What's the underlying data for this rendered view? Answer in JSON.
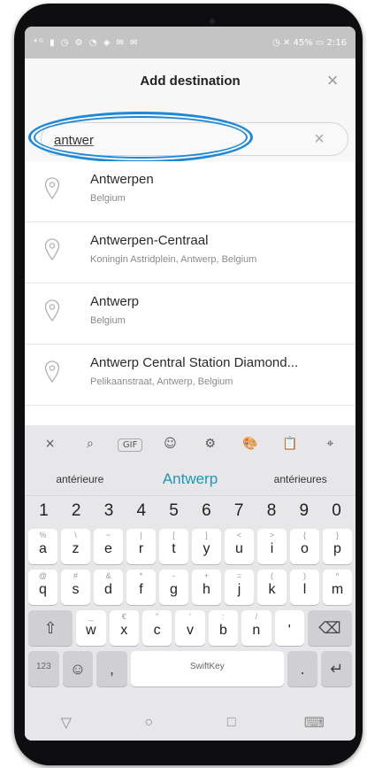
{
  "status_bar": {
    "left_icons": "⁴ᴳ ▮ ◷ ⚙ ◔ ◈ ✉ ✉",
    "right": "◷ ✕ 45% ▭ 2:16"
  },
  "header": {
    "title": "Add destination",
    "close_icon": "×"
  },
  "search": {
    "value": "antwer",
    "clear_icon": "×"
  },
  "results": [
    {
      "name": "Antwerpen",
      "sub": "Belgium"
    },
    {
      "name": "Antwerpen-Centraal",
      "sub": "Koningin Astridplein, Antwerp, Belgium"
    },
    {
      "name": "Antwerp",
      "sub": "Belgium"
    },
    {
      "name": "Antwerp Central Station Diamond...",
      "sub": "Pelikaanstraat, Antwerp, Belgium"
    }
  ],
  "keyboard": {
    "toolbar": [
      "×",
      "⌕",
      "GIF",
      "☺",
      "⚙",
      "🎨",
      "📋",
      "⌖"
    ],
    "suggestions": [
      "antérieure",
      "Antwerp",
      "antérieures"
    ],
    "numbers": [
      "1",
      "2",
      "3",
      "4",
      "5",
      "6",
      "7",
      "8",
      "9",
      "0"
    ],
    "row1": [
      {
        "main": "a",
        "alt": "%"
      },
      {
        "main": "z",
        "alt": "\\"
      },
      {
        "main": "e",
        "alt": "~"
      },
      {
        "main": "r",
        "alt": "|"
      },
      {
        "main": "t",
        "alt": "["
      },
      {
        "main": "y",
        "alt": "]"
      },
      {
        "main": "u",
        "alt": "<"
      },
      {
        "main": "i",
        "alt": ">"
      },
      {
        "main": "o",
        "alt": "{"
      },
      {
        "main": "p",
        "alt": "}"
      }
    ],
    "row2": [
      {
        "main": "q",
        "alt": "@"
      },
      {
        "main": "s",
        "alt": "#"
      },
      {
        "main": "d",
        "alt": "&"
      },
      {
        "main": "f",
        "alt": "*"
      },
      {
        "main": "g",
        "alt": "-"
      },
      {
        "main": "h",
        "alt": "+"
      },
      {
        "main": "j",
        "alt": "="
      },
      {
        "main": "k",
        "alt": "("
      },
      {
        "main": "l",
        "alt": ")"
      },
      {
        "main": "m",
        "alt": "^"
      }
    ],
    "row3": [
      {
        "main": "w",
        "alt": "_"
      },
      {
        "main": "x",
        "alt": "€"
      },
      {
        "main": "c",
        "alt": "\""
      },
      {
        "main": "v",
        "alt": "'"
      },
      {
        "main": "b",
        "alt": ":"
      },
      {
        "main": "n",
        "alt": "/"
      },
      {
        "main": "'",
        "alt": ""
      }
    ],
    "shift_icon": "⇧",
    "backspace_icon": "⌫",
    "symbols_key": "123",
    "emoji_icon": "☺",
    "comma_key": ",",
    "space_label": "SwiftKey",
    "period_key": ".",
    "enter_icon": "↵"
  },
  "nav_bar": {
    "back_icon": "▽",
    "home_icon": "○",
    "recents_icon": "□",
    "keyboard_icon": "⌨"
  }
}
